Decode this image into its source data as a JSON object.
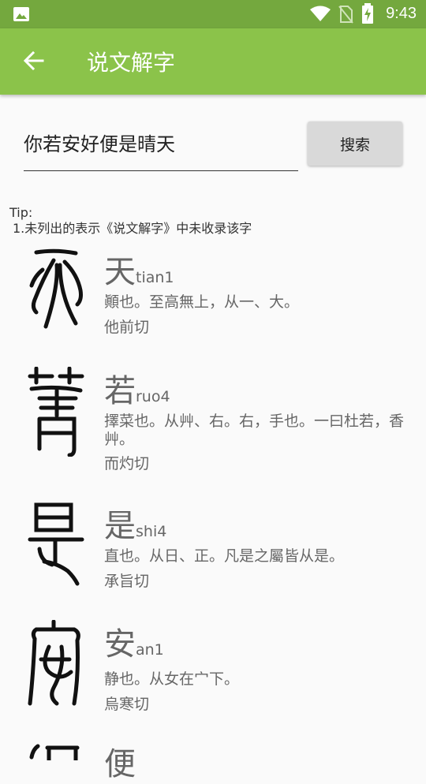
{
  "status_bar": {
    "time": "9:43"
  },
  "app_bar": {
    "title": "说文解字"
  },
  "search": {
    "value": "你若安好便是晴天",
    "button_label": "搜索"
  },
  "tip": {
    "title": "Tip:",
    "line": "1.未列出的表示《说文解字》中未收录该字"
  },
  "entries": [
    {
      "char": "天",
      "pinyin": "tian1",
      "definition": "顚也。至高無上，从一、大。",
      "fanqie": "他前切"
    },
    {
      "char": "若",
      "pinyin": "ruo4",
      "definition": "擇菜也。从艸、右。右，手也。一曰杜若，香艸。",
      "fanqie": "而灼切"
    },
    {
      "char": "是",
      "pinyin": "shi4",
      "definition": "直也。从日、正。凡是之屬皆从是。",
      "fanqie": "承旨切"
    },
    {
      "char": "安",
      "pinyin": "an1",
      "definition": "静也。从女在宀下。",
      "fanqie": "烏寒切"
    },
    {
      "char": "便",
      "pinyin": "",
      "definition": "",
      "fanqie": ""
    }
  ]
}
